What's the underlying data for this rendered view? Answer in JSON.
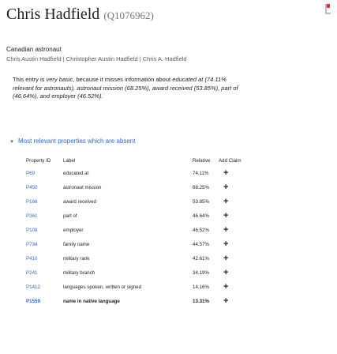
{
  "header": {
    "title": "Chris Hadfield",
    "qid": "(Q1076962)"
  },
  "description": "Canadian astronaut",
  "aliases": "Chris Austin Hadfield | Christopher Austin Hadfield | Chris A. Hadfield",
  "notice": {
    "lead": "This entry is ",
    "emph1": "very basic",
    "mid1": ", because it misses information about ",
    "emph2": "educated at (74.11% relevant for astronauts), astronaut mission (68.25%), award received (53.85%), part of (46.64%), and employer (46.52%).",
    "tail": ""
  },
  "section_toggle": {
    "arrow": "▼",
    "label": "Most relevant properties which are absent"
  },
  "table": {
    "headers": {
      "pid": "Property ID",
      "label": "Label",
      "relative": "Relative",
      "add": "Add Claim"
    },
    "rows": [
      {
        "pid": "P69",
        "label": "educated at",
        "relative": "74.11%",
        "add": "+"
      },
      {
        "pid": "P450",
        "label": "astronaut mission",
        "relative": "68.25%",
        "add": "+"
      },
      {
        "pid": "P166",
        "label": "award received",
        "relative": "53.85%",
        "add": "+"
      },
      {
        "pid": "P361",
        "label": "part of",
        "relative": "46.64%",
        "add": "+"
      },
      {
        "pid": "P108",
        "label": "employer",
        "relative": "46.52%",
        "add": "+"
      },
      {
        "pid": "P734",
        "label": "family name",
        "relative": "44.57%",
        "add": "+"
      },
      {
        "pid": "P410",
        "label": "military rank",
        "relative": "42.61%",
        "add": "+"
      },
      {
        "pid": "P241",
        "label": "military branch",
        "relative": "34.19%",
        "add": "+"
      },
      {
        "pid": "P1412",
        "label": "languages spoken, written or signed",
        "relative": "14.16%",
        "add": "+"
      },
      {
        "pid": "P1559",
        "label": "name in native language",
        "relative": "13.31%",
        "add": "+"
      }
    ]
  },
  "colors": {
    "link": "#3366cc",
    "icon_accent": "#d33"
  },
  "icons": {
    "corner": "bookmark-icon"
  }
}
